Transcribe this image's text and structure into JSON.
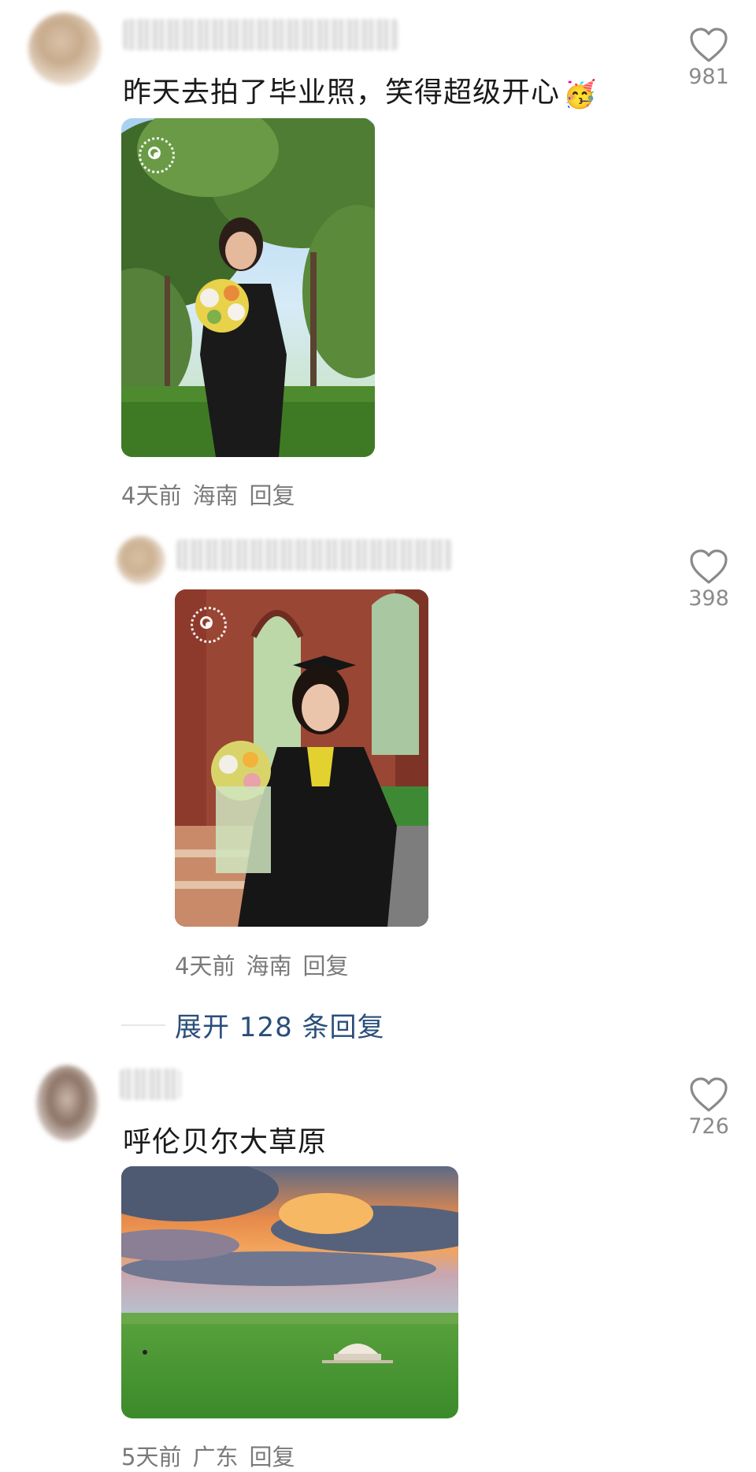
{
  "comments": [
    {
      "text": "昨天去拍了毕业照，笑得超级开心",
      "emoji": "🥳",
      "time": "4天前",
      "location": "海南",
      "reply_label": "回复",
      "likes": "981",
      "photo": "graduate-in-trees-photo"
    },
    {
      "text": "",
      "time": "4天前",
      "location": "海南",
      "reply_label": "回复",
      "likes": "398",
      "photo": "graduate-under-arches-photo"
    },
    {
      "text": "呼伦贝尔大草原",
      "time": "5天前",
      "location": "广东",
      "reply_label": "回复",
      "likes": "726",
      "photo": "grassland-sunset-photo"
    }
  ],
  "expand_replies_label": "展开 128 条回复",
  "icons": [
    "heart-icon",
    "live-photo-icon"
  ]
}
